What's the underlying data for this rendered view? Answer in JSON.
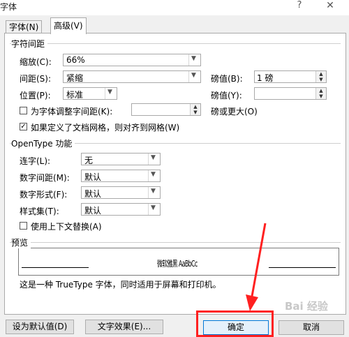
{
  "window": {
    "title": "字体",
    "help": "?",
    "close": "✕"
  },
  "tabs": [
    {
      "label": "字体(N)"
    },
    {
      "label": "高级(V)"
    }
  ],
  "char_spacing": {
    "section": "字符间距",
    "scale_label": "缩放(C):",
    "scale_value": "66%",
    "spacing_label": "间距(S):",
    "spacing_value": "紧缩",
    "spacing_pt_label": "磅值(B):",
    "spacing_pt_value": "1 磅",
    "position_label": "位置(P):",
    "position_value": "标准",
    "position_pt_label": "磅值(Y):",
    "position_pt_value": "",
    "kerning_label": "为字体调整字间距(K):",
    "kerning_value": "",
    "kerning_suffix": "磅或更大(O)",
    "grid_label": "如果定义了文档网格，则对齐到网格(W)"
  },
  "opentype": {
    "section": "OpenType 功能",
    "ligatures_label": "连字(L):",
    "ligatures_value": "无",
    "num_spacing_label": "数字间距(M):",
    "num_spacing_value": "默认",
    "num_form_label": "数字形式(F):",
    "num_form_value": "默认",
    "style_set_label": "样式集(T):",
    "style_set_value": "默认",
    "contextual_label": "使用上下文替换(A)"
  },
  "preview": {
    "section": "预览",
    "sample": "微软雅黑 AaBbCc",
    "description": "这是一种 TrueType 字体，同时适用于屏幕和打印机。"
  },
  "buttons": {
    "set_default": "设为默认值(D)",
    "text_effects": "文字效果(E)...",
    "ok": "确定",
    "cancel": "取消"
  },
  "watermark": "Bai 经验",
  "colors": {
    "highlight": "#ff2020",
    "accent": "#0078d7"
  }
}
